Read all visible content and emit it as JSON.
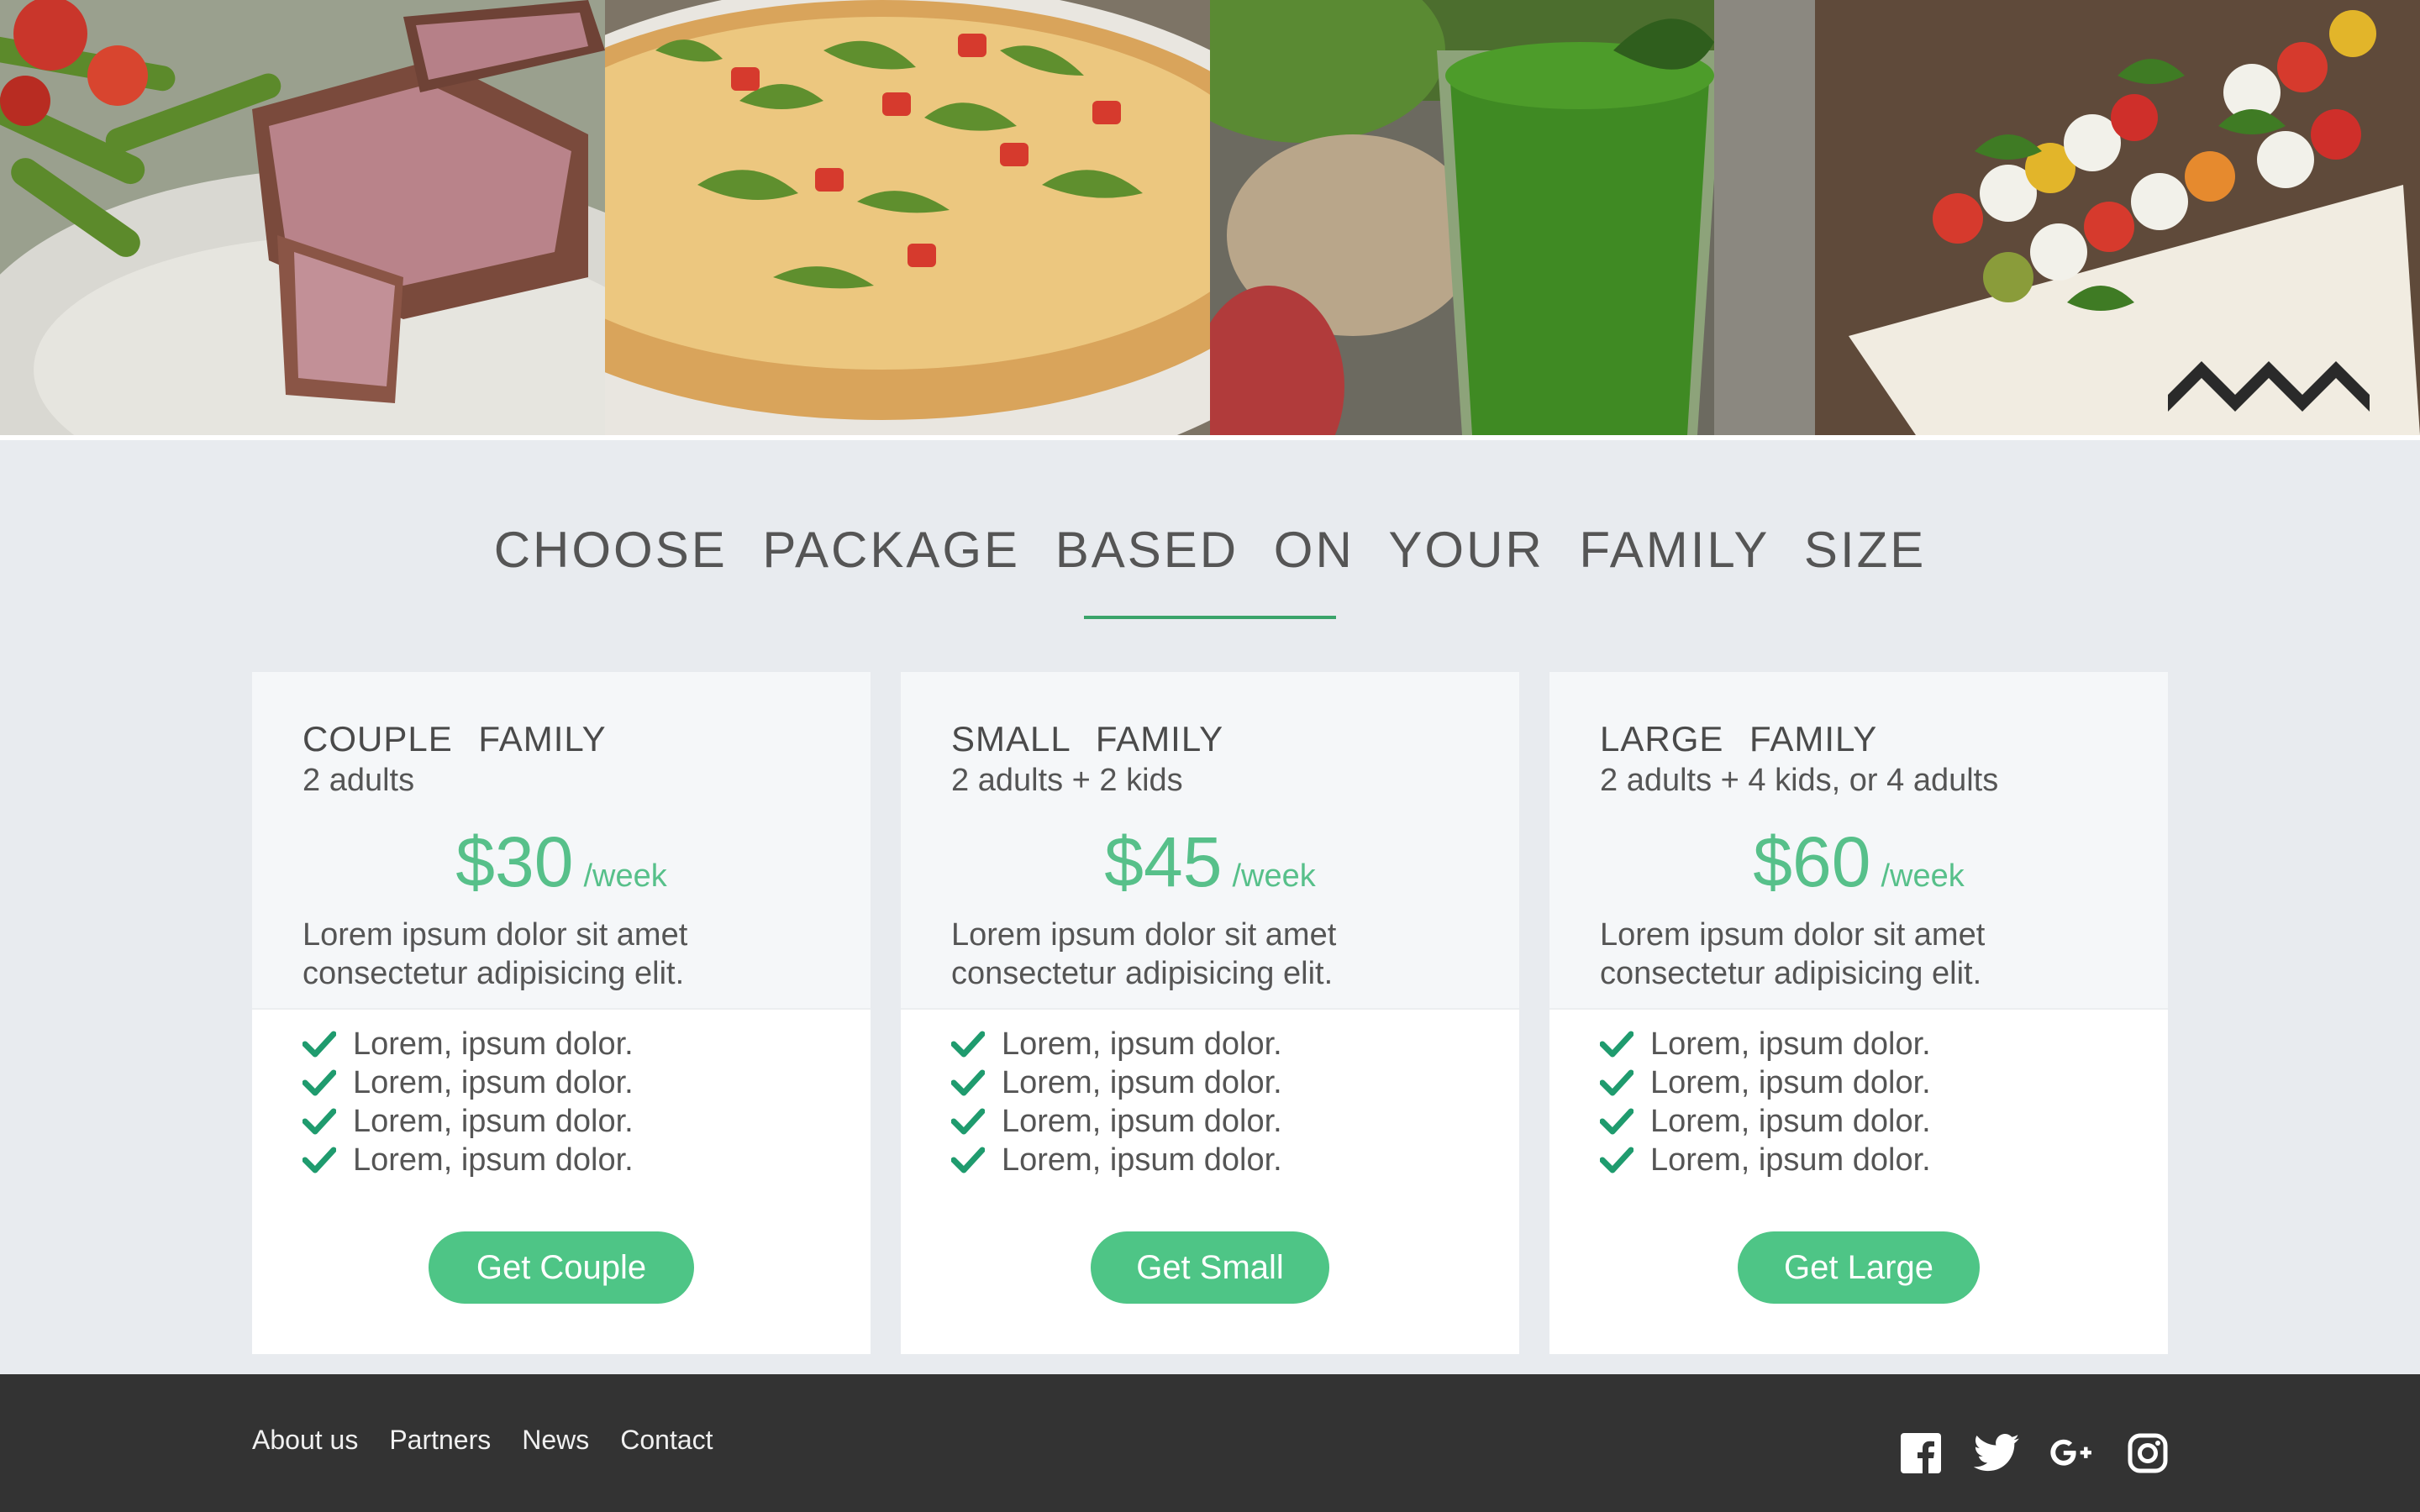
{
  "heading": "CHOOSE PACKAGE BASED ON YOUR FAMILY SIZE",
  "accent_color": "#4ec586",
  "gallery": [
    {
      "icon": "steak-photo"
    },
    {
      "icon": "pizza-photo"
    },
    {
      "icon": "green-smoothie-photo"
    },
    {
      "icon": "caprese-skewers-photo"
    }
  ],
  "packages": [
    {
      "title": "COUPLE FAMILY",
      "subtitle": "2 adults",
      "price": "$30",
      "period": "/week",
      "description": "Lorem ipsum dolor sit amet consectetur adipisicing elit.",
      "features": [
        "Lorem, ipsum dolor.",
        "Lorem, ipsum dolor.",
        "Lorem, ipsum dolor.",
        "Lorem, ipsum dolor."
      ],
      "button": "Get Couple"
    },
    {
      "title": "SMALL FAMILY",
      "subtitle": "2 adults + 2 kids",
      "price": "$45",
      "period": "/week",
      "description": "Lorem ipsum dolor sit amet consectetur adipisicing elit.",
      "features": [
        "Lorem, ipsum dolor.",
        "Lorem, ipsum dolor.",
        "Lorem, ipsum dolor.",
        "Lorem, ipsum dolor."
      ],
      "button": "Get Small"
    },
    {
      "title": "LARGE FAMILY",
      "subtitle": "2 adults + 4 kids, or 4 adults",
      "price": "$60",
      "period": "/week",
      "description": "Lorem ipsum dolor sit amet consectetur adipisicing elit.",
      "features": [
        "Lorem, ipsum dolor.",
        "Lorem, ipsum dolor.",
        "Lorem, ipsum dolor.",
        "Lorem, ipsum dolor."
      ],
      "button": "Get Large"
    }
  ],
  "footer": {
    "links": [
      "About us",
      "Partners",
      "News",
      "Contact"
    ],
    "social": [
      "facebook-icon",
      "twitter-icon",
      "google-plus-icon",
      "instagram-icon"
    ]
  }
}
